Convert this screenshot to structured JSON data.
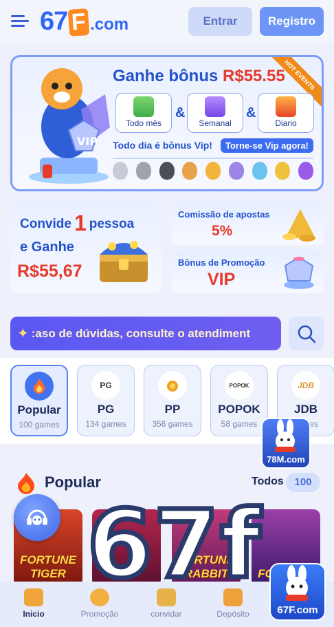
{
  "header": {
    "logo_num": "67",
    "logo_f": "F",
    "logo_domain": ".com",
    "login_label": "Entrar",
    "register_label": "Registro"
  },
  "vip_banner": {
    "title_prefix": "Ganhe bônus",
    "title_amount": "R$55.55",
    "hot_badge": "HOT EVENTS",
    "periods": [
      "Todo mês",
      "Semanal",
      "Diario"
    ],
    "amp": "&",
    "daily_text": "Todo dia é bônus Vip!",
    "cta": "Torne-se Vip agora!",
    "tiger_badge": "VIP"
  },
  "invite": {
    "line1_a": "Convide",
    "line1_num": "1",
    "line1_b": "pessoa",
    "line2": "e Ganhe",
    "amount": "R$55,67"
  },
  "promo_cards": [
    {
      "title": "Comissão de apostas",
      "value": "5%"
    },
    {
      "title": "Bônus de Promoção",
      "value": "VIP"
    }
  ],
  "marquee": {
    "text": ":aso de dúvidas, consulte o atendiment"
  },
  "categories": [
    {
      "badge": "",
      "name": "Popular",
      "count": "100 games"
    },
    {
      "badge": "PG",
      "name": "PG",
      "count": "134 games"
    },
    {
      "badge": "",
      "name": "PP",
      "count": "356 games"
    },
    {
      "badge": "POPOK",
      "name": "POPOK",
      "count": "58 games"
    },
    {
      "badge": "JDB",
      "name": "JDB",
      "count": "games"
    }
  ],
  "popular": {
    "title": "Popular",
    "all_label": "Todos",
    "all_count": "100",
    "games": [
      "FORTUNE TIGER",
      "",
      "FORTUNE RABBIT",
      "FORTUNE"
    ]
  },
  "floating": {
    "app1": "78M.com",
    "app2": "67F.com"
  },
  "watermark": "67f",
  "nav": [
    "Inicio",
    "Promoção",
    "convidar",
    "Depósito",
    ""
  ],
  "colors": {
    "primary": "#2f66f3",
    "accent_red": "#e63a2a",
    "register": "#6c95f5"
  }
}
